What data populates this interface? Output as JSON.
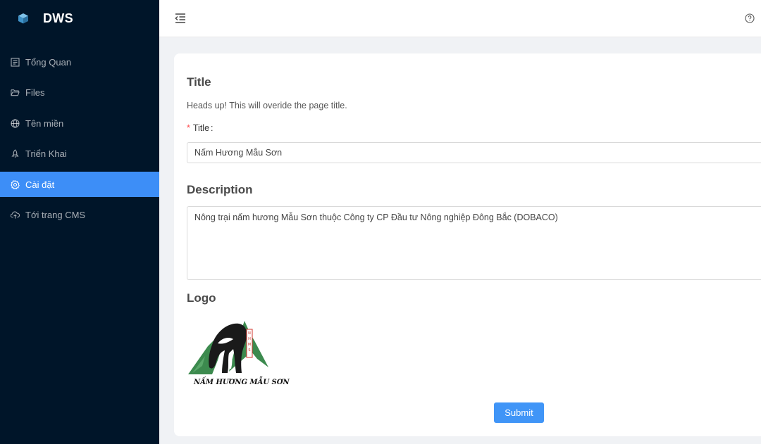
{
  "app": {
    "name": "DWS"
  },
  "sidebar": {
    "items": [
      {
        "label": "Tổng Quan",
        "icon": "dashboard-icon"
      },
      {
        "label": "Files",
        "icon": "folder-open-icon"
      },
      {
        "label": "Tên miền",
        "icon": "globe-icon"
      },
      {
        "label": "Triển Khai",
        "icon": "rocket-icon"
      },
      {
        "label": "Cài đặt",
        "icon": "gear-icon",
        "active": true
      },
      {
        "label": "Tới trang CMS",
        "icon": "cloud-upload-icon"
      }
    ]
  },
  "header": {
    "fold_icon": "menu-fold-icon",
    "help_icon": "question-circle-icon"
  },
  "form": {
    "title_section": "Title",
    "title_hint": "Heads up! This will overide the page title.",
    "title_label": "Title",
    "title_required": "*",
    "title_suffix": ":",
    "title_value": "Nấm Hương Mẫu Sơn",
    "description_section": "Description",
    "description_value": "Nông trại nấm hương Mẫu Sơn thuộc Công ty CP Đầu tư Nông nghiệp Đông Bắc (DOBACO)",
    "logo_section": "Logo",
    "logo_caption": "NẤM HƯƠNG MẪU SƠN",
    "submit_label": "Submit"
  },
  "colors": {
    "sidebar_bg": "#001529",
    "active_item": "#3d8ef7",
    "primary": "#4095f7",
    "logo_green": "#3c8a4e",
    "logo_red": "#d0342c"
  }
}
